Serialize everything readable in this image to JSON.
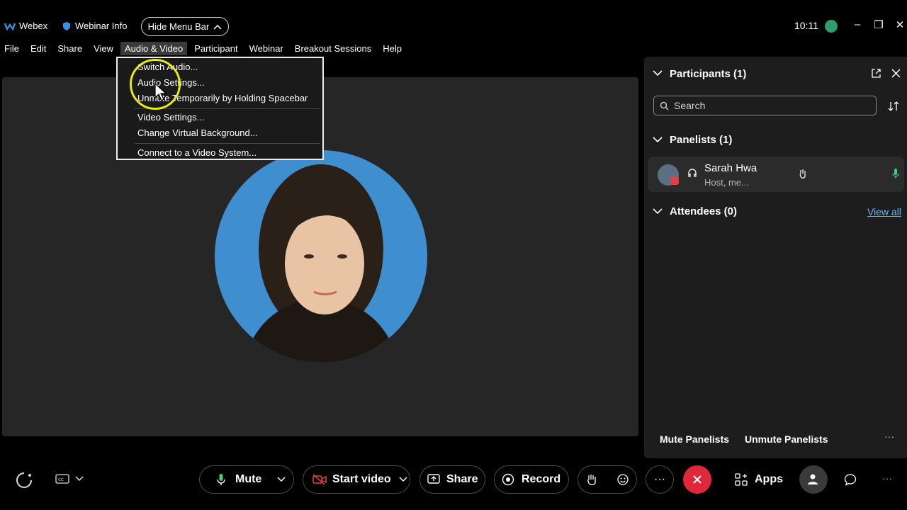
{
  "titlebar": {
    "app_name": "Webex",
    "webinar_info": "Webinar Info",
    "hide_menu_bar": "Hide Menu Bar",
    "clock": "10:11"
  },
  "menubar": {
    "items": [
      "File",
      "Edit",
      "Share",
      "View",
      "Audio & Video",
      "Participant",
      "Webinar",
      "Breakout Sessions",
      "Help"
    ],
    "active_index": 4
  },
  "dropdown": {
    "items": [
      "Switch Audio...",
      "Audio Settings...",
      "Unmute Temporarily by Holding Spacebar",
      "Video Settings...",
      "Change Virtual Background...",
      "Connect to a Video System..."
    ]
  },
  "panel": {
    "title": "Participants (1)",
    "search_placeholder": "Search",
    "panelists_title": "Panelists (1)",
    "attendees_title": "Attendees (0)",
    "view_all": "View all",
    "panelist": {
      "name": "Sarah Hwa",
      "role": "Host, me..."
    },
    "mute_panelists": "Mute Panelists",
    "unmute_panelists": "Unmute Panelists"
  },
  "toolbar": {
    "mute": "Mute",
    "start_video": "Start video",
    "share": "Share",
    "record": "Record",
    "apps": "Apps"
  },
  "colors": {
    "background": "#000000",
    "stage": "#262626",
    "panel": "#1d1d1d",
    "end_call": "#e0283b",
    "link": "#6cb4ff",
    "highlight_ring": "#e8e817",
    "avatar_bg": "#3f8fd0"
  }
}
